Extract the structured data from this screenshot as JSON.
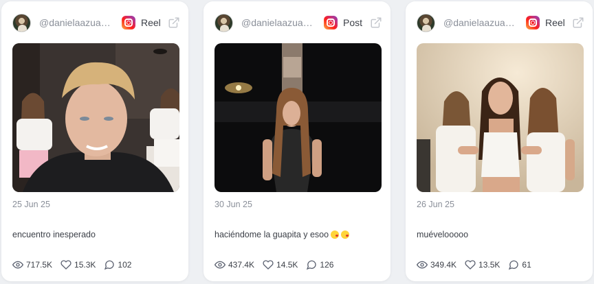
{
  "cards": [
    {
      "handle": "@danielaazuag...",
      "post_type": "Reel",
      "date": "25 Jun 25",
      "caption": "encuentro inesperado",
      "views": "717.5K",
      "likes": "15.3K",
      "comments": "102"
    },
    {
      "handle": "@danielaazuag...",
      "post_type": "Post",
      "date": "30 Jun 25",
      "caption": "haciéndome la guapita y esoo",
      "caption_emojis": [
        "kissing-face-emoji",
        "kissing-face-emoji"
      ],
      "views": "437.4K",
      "likes": "14.5K",
      "comments": "126"
    },
    {
      "handle": "@danielaazuag...",
      "post_type": "Reel",
      "date": "26 Jun 25",
      "caption": "muévelooooo",
      "views": "349.4K",
      "likes": "13.5K",
      "comments": "61"
    }
  ],
  "icons": {
    "platform": "instagram-icon",
    "open": "external-link-icon",
    "views": "eye-icon",
    "likes": "heart-icon",
    "comments": "comment-icon"
  },
  "colors": {
    "page_bg": "#eef0f3",
    "card_bg": "#ffffff",
    "muted_text": "#8a8f99",
    "body_text": "#3b3f47"
  }
}
